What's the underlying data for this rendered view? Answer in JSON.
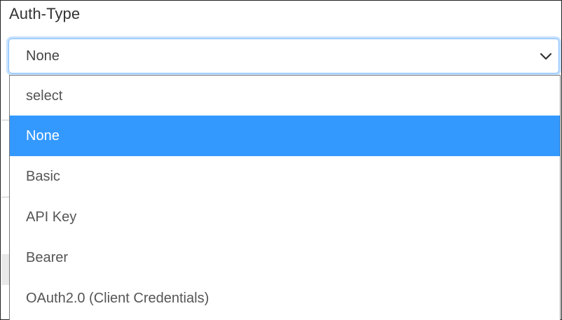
{
  "field": {
    "label": "Auth-Type"
  },
  "select": {
    "value": "None",
    "chevron_icon": "chevron-down-icon"
  },
  "dropdown": {
    "options": [
      {
        "label": "select",
        "selected": false
      },
      {
        "label": "None",
        "selected": true
      },
      {
        "label": "Basic",
        "selected": false
      },
      {
        "label": "API Key",
        "selected": false
      },
      {
        "label": "Bearer",
        "selected": false
      },
      {
        "label": "OAuth2.0 (Client Credentials)",
        "selected": false
      }
    ]
  },
  "colors": {
    "selected_bg": "#3399ff",
    "selected_text": "#ffffff",
    "focus_border": "#80bdff",
    "text": "#555555"
  }
}
